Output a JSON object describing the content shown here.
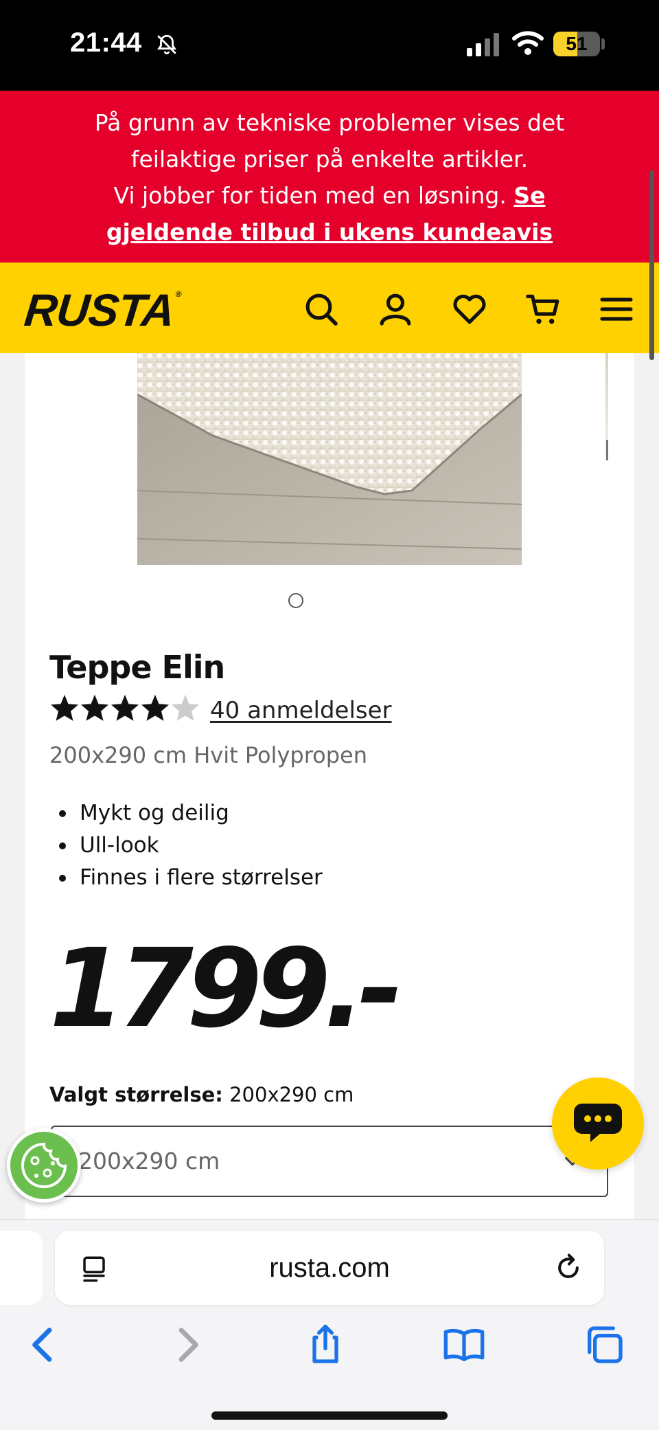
{
  "status_bar": {
    "time": "21:44",
    "battery": "51",
    "battery_level": 0.51
  },
  "notice": {
    "line1": "På grunn av tekniske problemer vises det",
    "line2": "feilaktige priser på enkelte artikler.",
    "line3": "Vi jobber for tiden med en løsning.",
    "link_part1": "Se",
    "link_part2": "gjeldende tilbud i ukens kundeavis"
  },
  "header": {
    "logo": "RUSTA",
    "logo_mark": "®",
    "icons": [
      "search-icon",
      "account-icon",
      "heart-icon",
      "cart-icon",
      "menu-icon"
    ]
  },
  "product": {
    "title": "Teppe Elin",
    "rating": 4.5,
    "rating_max": 5,
    "reviews": "40 anmeldelser",
    "subtitle": "200x290 cm Hvit Polypropen",
    "features": [
      "Mykt og deilig",
      "Ull-look",
      "Finnes i flere størrelser"
    ],
    "price": "1799.-",
    "selected_size_label": "Valgt størrelse:",
    "selected_size_value": "200x290 cm",
    "size_select_value": "200x290 cm"
  },
  "browser": {
    "domain": "rusta.com",
    "nav_icons": [
      "back-icon",
      "forward-icon",
      "share-icon",
      "bookmarks-icon",
      "tabs-icon"
    ]
  },
  "colors": {
    "notice_bg": "#e4002b",
    "header_bg": "#ffd100",
    "accent_blue": "#1a73e8",
    "cookie_green": "#6bbf4e"
  }
}
